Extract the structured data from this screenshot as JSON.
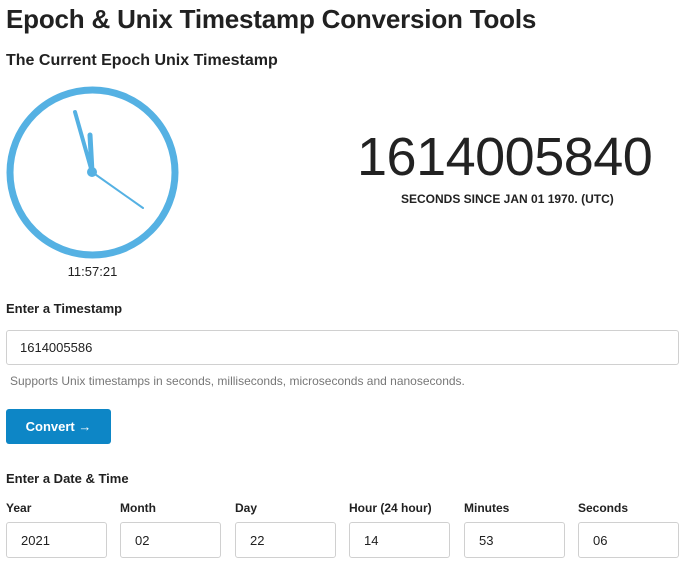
{
  "header": {
    "title": "Epoch & Unix Timestamp Conversion Tools",
    "subtitle": "The Current Epoch Unix Timestamp"
  },
  "clock": {
    "time": "11:57:21",
    "ring_color": "#55b1e3",
    "hand_color": "#55b1e3"
  },
  "current_epoch": {
    "value": "1614005840",
    "caption": "SECONDS SINCE JAN 01 1970. (UTC)"
  },
  "timestamp_form": {
    "label": "Enter a Timestamp",
    "value": "1614005586",
    "help": "Supports Unix timestamps in seconds, milliseconds, microseconds and nanoseconds.",
    "convert_label": "Convert →",
    "button_color": "#0d86c6"
  },
  "datetime_form": {
    "label": "Enter a Date & Time",
    "fields": [
      {
        "label": "Year",
        "value": "2021"
      },
      {
        "label": "Month",
        "value": "02"
      },
      {
        "label": "Day",
        "value": "22"
      },
      {
        "label": "Hour (24 hour)",
        "value": "14"
      },
      {
        "label": "Minutes",
        "value": "53"
      },
      {
        "label": "Seconds",
        "value": "06"
      }
    ]
  }
}
